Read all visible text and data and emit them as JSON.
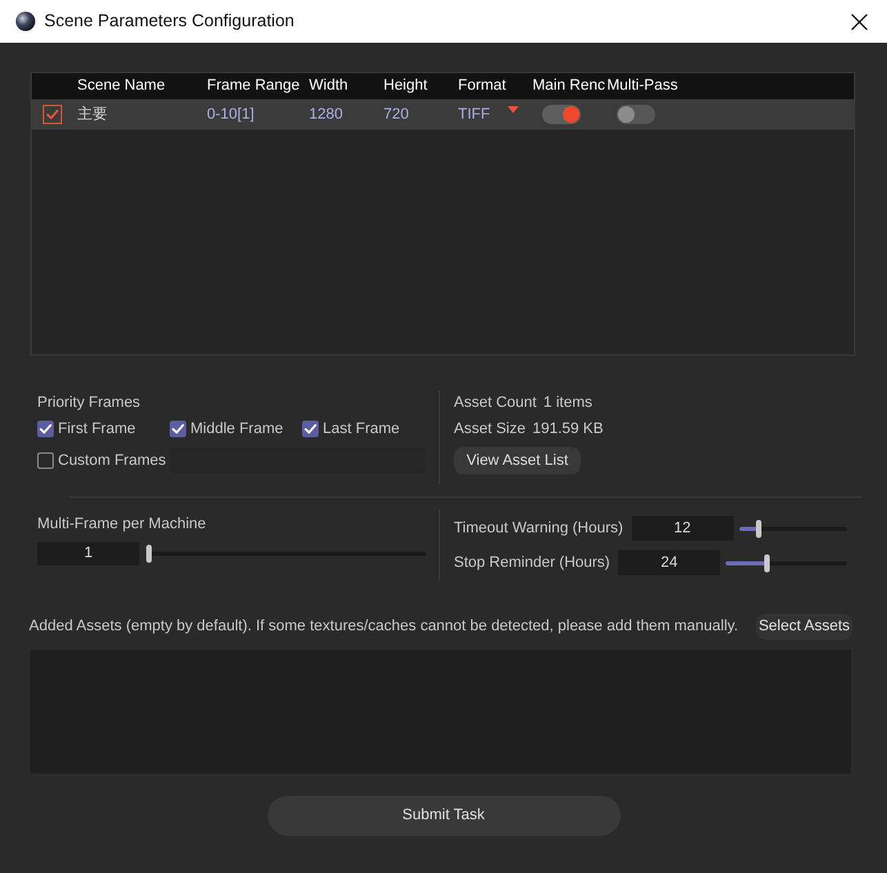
{
  "window": {
    "title": "Scene Parameters Configuration"
  },
  "scene_table": {
    "columns": [
      "Scene Name",
      "Frame Range",
      "Width",
      "Height",
      "Format",
      "Main Renc",
      "Multi-Pass"
    ],
    "rows": [
      {
        "checked": true,
        "cells": [
          "主要",
          "0-10[1]",
          "1280",
          "720",
          "TIFF"
        ],
        "toggles": [
          {
            "on": true
          },
          {
            "on": false
          }
        ]
      }
    ]
  },
  "priority_frames": {
    "label": "Priority Frames",
    "options": [
      {
        "label": "First Frame",
        "checked": true
      },
      {
        "label": "Middle Frame",
        "checked": true
      },
      {
        "label": "Last Frame",
        "checked": true
      }
    ],
    "custom": {
      "label": "Custom Frames",
      "checked": false
    }
  },
  "asset_info": {
    "items": [
      {
        "label": "Asset Count",
        "value": "1 items"
      },
      {
        "label": "Asset Size",
        "value": "191.59 KB"
      }
    ],
    "button": "View Asset List"
  },
  "multi_frame": {
    "label": "Multi-Frame per Machine",
    "value": "1",
    "level": 0
  },
  "reminders": [
    {
      "label": "Timeout Warning (Hours)",
      "value": "12",
      "level": 0.17
    },
    {
      "label": "Stop Reminder (Hours)",
      "value": "24",
      "level": 0.33
    }
  ],
  "added_assets": {
    "hint": "Added Assets (empty by default). If some textures/caches cannot be detected, please add them manually.",
    "button": "Select Assets"
  },
  "submit_button": "Submit Task"
}
